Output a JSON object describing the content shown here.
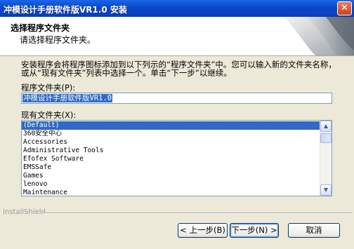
{
  "window": {
    "title": "冲模设计手册软件版VR1.0 安装",
    "close_glyph": "✕"
  },
  "header": {
    "title": "选择程序文件夹",
    "subtitle": "请选择程序文件夹。"
  },
  "description": "安装程序会将程序图标添加到以下列示的“程序文件夹”中。您可以输入新的文件夹名称，或从“现有文件夹”列表中选择一个。单击“下一步”以继续。",
  "program_folder": {
    "label": "程序文件夹(P):",
    "value": "冲模设计手册软件版VR1.0"
  },
  "existing_folders": {
    "label": "现有文件夹(X):",
    "items": [
      "(Default)",
      "360安全中心",
      "Accessories",
      "Administrative Tools",
      "Efofex Software",
      "EMSSafe",
      "Games",
      "lenovo",
      "Maintenance"
    ],
    "selected_index": 0
  },
  "footer": {
    "brand": "InstallShield"
  },
  "buttons": {
    "back": "< 上一步(B)",
    "next": "下一步(N) >",
    "cancel": "取消"
  },
  "icons": {
    "scroll_up": "up-arrow-icon",
    "scroll_down": "down-arrow-icon",
    "close": "close-icon"
  }
}
